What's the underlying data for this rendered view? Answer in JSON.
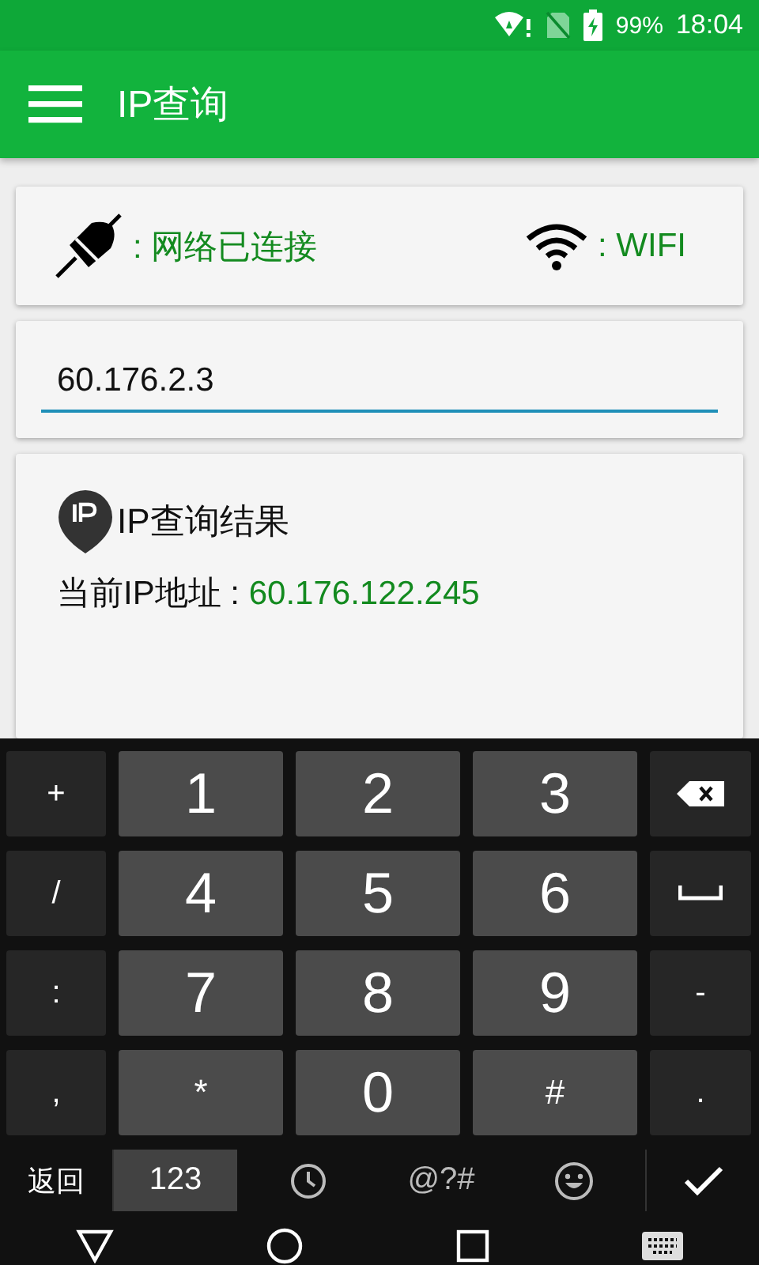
{
  "status_bar": {
    "battery": "99%",
    "time": "18:04"
  },
  "app_bar": {
    "title": "IP查询"
  },
  "connection": {
    "network": ": 网络已连接",
    "type": ": WIFI"
  },
  "ip_field": {
    "value": "60.176.2.3"
  },
  "result": {
    "title": "IP查询结果",
    "rows": [
      {
        "label": "当前IP地址 : ",
        "value": "60.176.122.245"
      }
    ]
  },
  "keyboard": {
    "rows": [
      [
        {
          "kind": "symbol",
          "label": "+"
        },
        {
          "kind": "digit",
          "label": "1"
        },
        {
          "kind": "digit",
          "label": "2"
        },
        {
          "kind": "digit",
          "label": "3"
        },
        {
          "kind": "backspace"
        }
      ],
      [
        {
          "kind": "symbol",
          "label": "/"
        },
        {
          "kind": "digit",
          "label": "4"
        },
        {
          "kind": "digit",
          "label": "5"
        },
        {
          "kind": "digit",
          "label": "6"
        },
        {
          "kind": "space"
        }
      ],
      [
        {
          "kind": "symbol",
          "label": ":"
        },
        {
          "kind": "digit",
          "label": "7"
        },
        {
          "kind": "digit",
          "label": "8"
        },
        {
          "kind": "digit",
          "label": "9"
        },
        {
          "kind": "symbol",
          "label": "-"
        }
      ],
      [
        {
          "kind": "symbol",
          "label": ","
        },
        {
          "kind": "sign",
          "label": "*"
        },
        {
          "kind": "digit",
          "label": "0"
        },
        {
          "kind": "sign",
          "label": "#"
        },
        {
          "kind": "symbol",
          "label": "."
        }
      ]
    ],
    "back": "返回",
    "modes": [
      {
        "kind": "text",
        "label": "123",
        "selected": true
      },
      {
        "kind": "recent",
        "selected": false
      },
      {
        "kind": "text",
        "label": "@?#",
        "selected": false
      },
      {
        "kind": "emoji",
        "selected": false
      }
    ]
  }
}
